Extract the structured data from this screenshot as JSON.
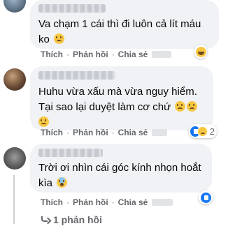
{
  "actions": {
    "like": "Thích",
    "reply": "Phản hồi",
    "share": "Chia sẻ"
  },
  "comments": [
    {
      "text_line1": "Va chạm 1 cái thì đi luôn cả lít máu",
      "text_line2": "ko",
      "reaction": "haha",
      "reaction_count": ""
    },
    {
      "text_line1": "Huhu vừa xấu mà vừa nguy hiểm.",
      "text_line2": "Tại sao lại duyệt làm cơ chứ",
      "reaction": "like-sad",
      "reaction_count": "2"
    },
    {
      "text_line1": "Trời ơi nhìn cái góc kính nhọn hoắt",
      "text_line2": "kìa",
      "reaction": "like",
      "reaction_count": ""
    }
  ],
  "replies_link": "1 phản hồi",
  "colors": {
    "bubble": "#f0f2f5",
    "meta_text": "#65676b",
    "like_blue": "#1877f2",
    "emoji_yellow": "#f7c744"
  }
}
